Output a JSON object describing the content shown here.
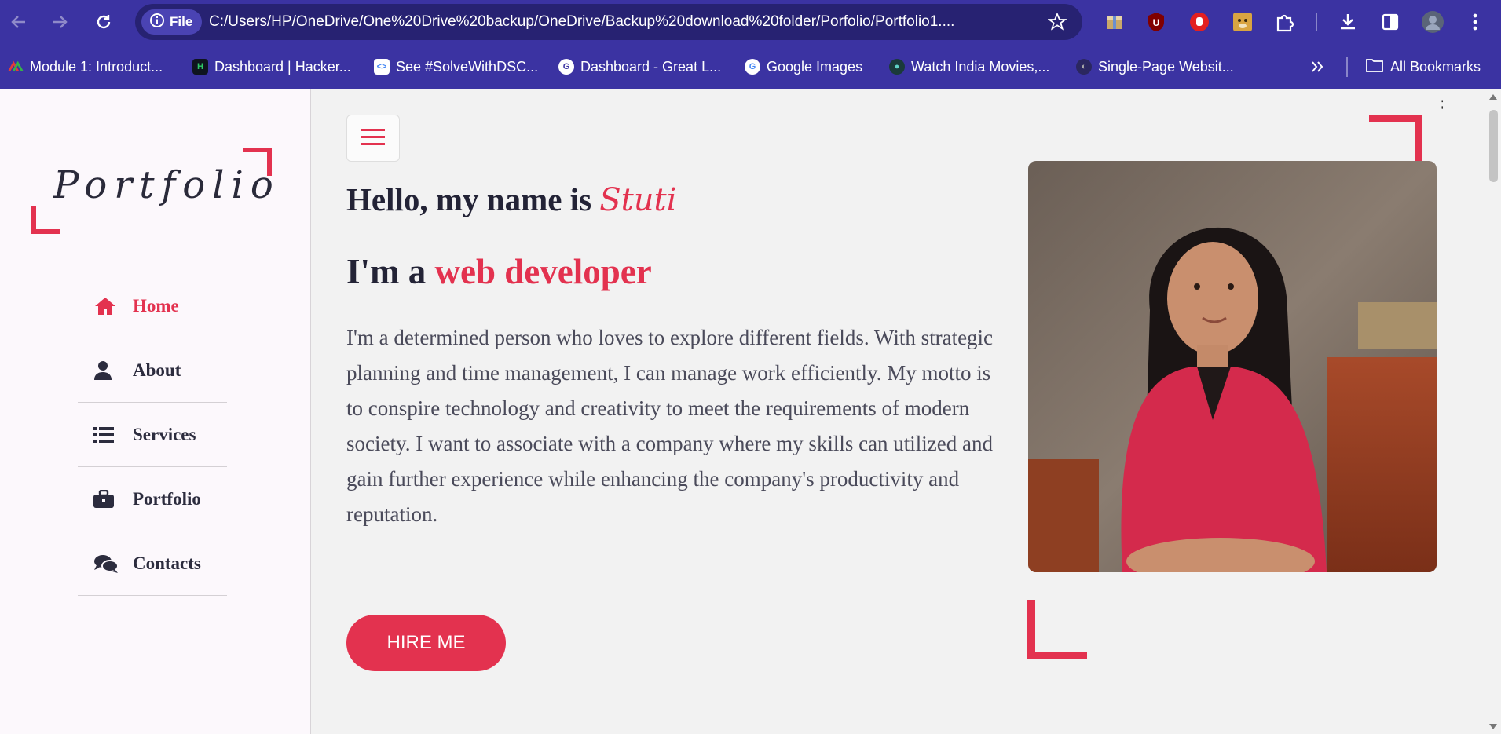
{
  "browser": {
    "file_chip": "File",
    "url": "C:/Users/HP/OneDrive/One%20Drive%20backup/OneDrive/Backup%20download%20folder/Porfolio/Portfolio1....",
    "bookmarks": [
      "Module 1: Introduct...",
      "Dashboard | Hacker...",
      "See #SolveWithDSC...",
      "Dashboard - Great L...",
      "Google Images",
      "Watch India Movies,...",
      "Single-Page Websit..."
    ],
    "all_bookmarks": "All Bookmarks"
  },
  "sidebar": {
    "logo": "Portfolio",
    "nav": [
      {
        "label": "Home",
        "icon": "home-icon",
        "active": true
      },
      {
        "label": "About",
        "icon": "user-icon",
        "active": false
      },
      {
        "label": "Services",
        "icon": "list-icon",
        "active": false
      },
      {
        "label": "Portfolio",
        "icon": "briefcase-icon",
        "active": false
      },
      {
        "label": "Contacts",
        "icon": "chat-icon",
        "active": false
      }
    ]
  },
  "hero": {
    "greeting": "Hello, my name is ",
    "name": "Stuti",
    "role_prefix": "I'm a ",
    "role": "web developer",
    "description": "I'm a determined person who loves to explore different fields. With strategic planning and time management, I can manage work efficiently. My motto is to conspire technology and creativity to meet the requirements of modern society. I want to associate with a company where my skills can utilized and gain further experience while enhancing the company's productivity and reputation.",
    "cta": "HIRE ME"
  },
  "stray_text": ";",
  "colors": {
    "accent": "#e3324f",
    "browser": "#3b33a2",
    "text": "#232336"
  }
}
